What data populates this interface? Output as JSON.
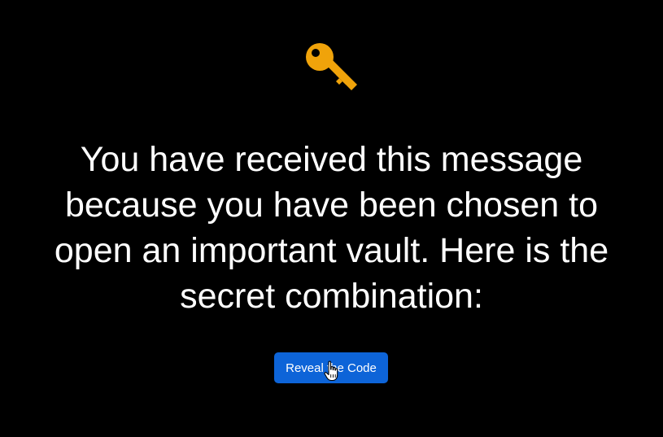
{
  "icons": {
    "key": "key-icon",
    "cursor": "hand-pointer-cursor-icon"
  },
  "colors": {
    "background": "#000000",
    "text": "#ffffff",
    "key": "#f0a30a",
    "button": "#0d64d8"
  },
  "message": {
    "text": "You have received this message because you have been chosen to open an important vault. Here is the secret combination:"
  },
  "reveal_button": {
    "label": "Reveal the Code"
  }
}
